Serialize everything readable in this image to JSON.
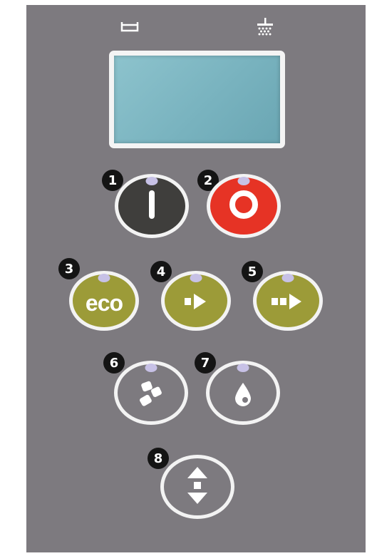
{
  "top_icons": {
    "left": "wash-tub-icon",
    "right": "shower-icon"
  },
  "display": {
    "value": ""
  },
  "buttons": [
    {
      "number": "1",
      "function": "power-on",
      "icon": "power-bar-icon",
      "color": "#3f3e3c"
    },
    {
      "number": "2",
      "function": "power-off",
      "icon": "power-ring-icon",
      "color": "#e63325"
    },
    {
      "number": "3",
      "function": "eco",
      "label": "eco",
      "color": "#9c9b38"
    },
    {
      "number": "4",
      "function": "program-short",
      "icon": "single-arrow-icon",
      "color": "#9c9b38"
    },
    {
      "number": "5",
      "function": "program-long",
      "icon": "double-arrow-icon",
      "color": "#9c9b38"
    },
    {
      "number": "6",
      "function": "detergent",
      "icon": "tablets-icon",
      "color": "transparent"
    },
    {
      "number": "7",
      "function": "rinse-aid",
      "icon": "drop-icon",
      "color": "transparent"
    },
    {
      "number": "8",
      "function": "menu-up-down",
      "icon": "up-down-arrows-icon",
      "color": "transparent"
    }
  ],
  "colors": {
    "panel": "#7d7a7f",
    "led": "#c7c1e6",
    "badge": "#141414",
    "ring": "#f3f3f3"
  }
}
